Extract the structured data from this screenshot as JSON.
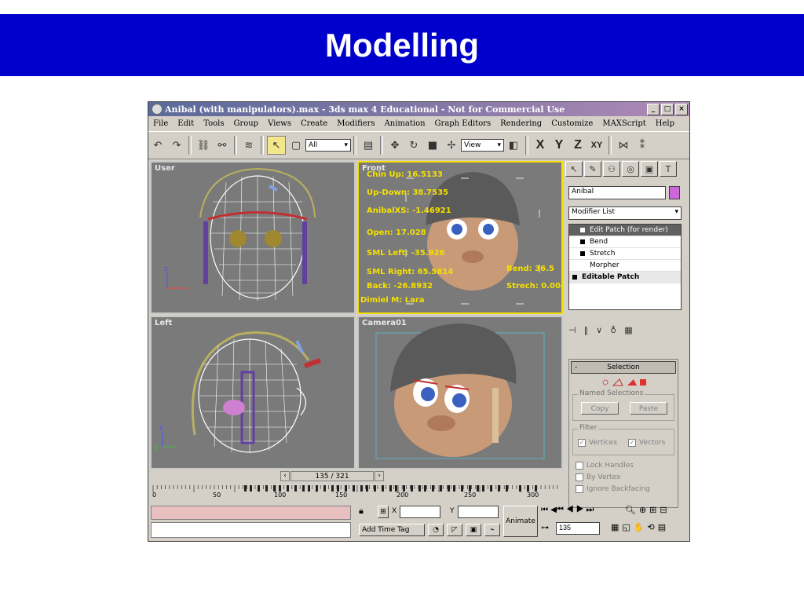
{
  "slide": {
    "title": "Modelling"
  },
  "window": {
    "title": "Anibal (with manipulators).max - 3ds max 4 Educational - Not for Commercial Use",
    "menu": [
      "File",
      "Edit",
      "Tools",
      "Group",
      "Views",
      "Create",
      "Modifiers",
      "Animation",
      "Graph Editors",
      "Rendering",
      "Customize",
      "MAXScript",
      "Help"
    ],
    "toolbar": {
      "selection_filter": "All",
      "coord_system": "View",
      "axis_labels": [
        "X",
        "Y",
        "Z",
        "XY"
      ]
    }
  },
  "viewports": {
    "top_left": {
      "label": "User"
    },
    "top_right": {
      "label": "Front",
      "overlays": [
        "Chin Up: 16.5133",
        "Up-Down: 38.7535",
        "AnibalXS: -1.46921",
        "Open: 17.028",
        "SML Left: -35.926",
        "SML Right: 65.5814",
        "Back: -26.8932",
        "Dimiel M: Lara",
        "Bend: 36.5",
        "Strech: 0.004"
      ]
    },
    "bottom_left": {
      "label": "Left"
    },
    "bottom_right": {
      "label": "Camera01"
    }
  },
  "command_panel": {
    "object_name": "Anibal",
    "modifier_list": "Modifier List",
    "stack": [
      "Edit Patch (for render)",
      "Bend",
      "Stretch",
      "Morpher",
      "Editable Patch"
    ],
    "rollout": {
      "title": "Selection",
      "named_selections": "Named Selections",
      "copy": "Copy",
      "paste": "Paste",
      "filter": "Filter",
      "vertices": "Vertices",
      "vectors": "Vectors",
      "lock_handles": "Lock Handles",
      "by_vertex": "By Vertex",
      "ignore_backfacing": "Ignore Backfacing"
    }
  },
  "timeline": {
    "slider": "135 / 321",
    "ticks": [
      "0",
      "50",
      "100",
      "150",
      "200",
      "250",
      "300"
    ]
  },
  "status": {
    "x_label": "X",
    "y_label": "Y",
    "add_time_tag": "Add Time Tag",
    "animate": "Animate",
    "frame": "135"
  },
  "colors": {
    "banner": "#0000cc",
    "viewport_bg": "#7a7a7a",
    "active_border": "#f5e000",
    "overlay_text": "#f5e000",
    "object_swatch": "#cc66dd"
  }
}
